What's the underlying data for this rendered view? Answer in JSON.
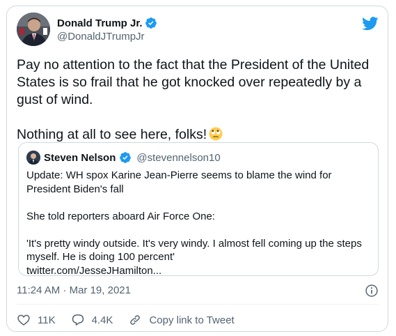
{
  "author": {
    "display_name": "Donald Trump Jr.",
    "handle": "@DonaldJTrumpJr"
  },
  "tweet": {
    "paragraph_1": "Pay no attention to the fact that the President of the United States is so frail that he got knocked over repeatedly by a gust of wind.",
    "paragraph_2": "Nothing at all to see here, folks!",
    "emoji": "face-with-rolling-eyes"
  },
  "quoted_tweet": {
    "display_name": "Steven Nelson",
    "handle": "@stevennelson10",
    "line_1": "Update: WH spox Karine Jean-Pierre seems to blame the wind for President Biden's fall",
    "line_2": "She told reporters aboard Air Force One:",
    "line_3": "'It's pretty windy outside. It's very windy. I almost fell coming up the steps myself. He is doing 100 percent'",
    "line_4": "twitter.com/JesseJHamilton..."
  },
  "meta": {
    "timestamp": "11:24 AM · Mar 19, 2021"
  },
  "actions": {
    "likes": "11K",
    "replies": "4.4K",
    "copy_link": "Copy link to Tweet"
  },
  "colors": {
    "verified": "#1d9bf0",
    "twitter_bird": "#1d9bf0",
    "secondary_text": "#536471",
    "border": "#cfd9de"
  }
}
